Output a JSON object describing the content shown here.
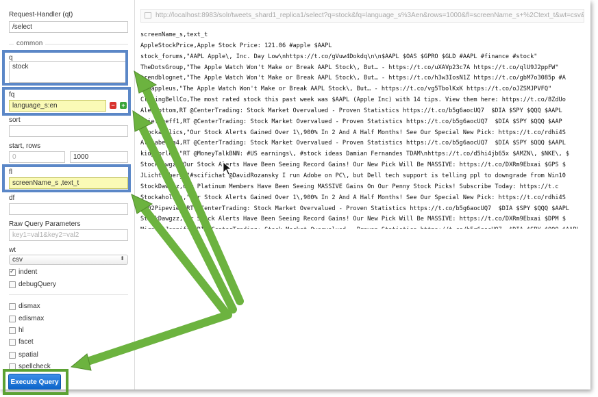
{
  "form": {
    "qt_label": "Request-Handler (qt)",
    "qt_value": "/select",
    "common_label": "common",
    "q_label": "q",
    "q_value": "stock",
    "fq_label": "fq",
    "fq_value": "language_s:en",
    "sort_label": "sort",
    "sort_value": "",
    "start_rows_label": "start, rows",
    "start_value": "0",
    "rows_value": "1000",
    "fl_label": "fl",
    "fl_value": "screenName_s ,text_t",
    "df_label": "df",
    "df_value": "",
    "raw_label": "Raw Query Parameters",
    "raw_placeholder": "key1=val1&key2=val2",
    "wt_label": "wt",
    "wt_value": "csv",
    "indent_label": "indent",
    "indent_checked": true,
    "debug_label": "debugQuery",
    "dismax_label": "dismax",
    "edismax_label": "edismax",
    "hl_label": "hl",
    "facet_label": "facet",
    "spatial_label": "spatial",
    "spellcheck_label": "spellcheck",
    "execute_label": "Execute Query"
  },
  "url": "http://localhost:8983/solr/tweets_shard1_replica1/select?q=stock&fq=language_s%3Aen&rows=1000&fl=screenName_s+%2Ctext_t&wt=csv&indent=true",
  "output_lines": [
    "screenName_s,text_t",
    "AppleStockPrice,Apple Stock Price: 121.06 #apple $AAPL",
    "stock_forums,\"AAPL Apple\\, Inc. Day Low\\nhttps://t.co/gVuw4Dokdq\\n\\n$AAPL $OAS $GPRO $GLD #AAPL #finance #stock\"",
    "TheDotsGroup,\"The Apple Watch Won't Make or Break AAPL Stock\\, But… - https://t.co/uXAVp23c7A https://t.co/qlU9J2ppFW\"",
    "trendblognet,\"The Apple Watch Won't Make or Break AAPL Stock\\, But… - https://t.co/h3w3IosN1Z https://t.co/gbM7o3085p #A",
    "appappleus,\"The Apple Watch Won't Make or Break AAPL Stock\\, But… - https://t.co/vg5TbolKxK https://t.co/oJZSMJPVFQ\"",
    "ClosingBellCo,The most rated stock this past week was $AAPL (Apple Inc) with 14 tips. View them here: https://t.co/8ZdUo",
    "AlexBottom,RT @CenterTrading: Stock Market Overvalued - Proven Statistics https://t.co/b5g6aocUQ7  $DIA $SPY $QQQ $AAPL",
    "chiefkeeff1,RT @CenterTrading: Stock Market Overvalued - Proven Statistics https://t.co/b5g6aocUQ7  $DIA $SPY $QQQ $AAP",
    "Stockaholics,\"Our Stock Alerts Gained Over 1\\,900% In 2 And A Half Months! See Our Special New Pick: https://t.co/rdhi4S",
    "Alisabella4,RT @CenterTrading: Stock Market Overvalued - Proven Statistics https://t.co/b5g6aocUQ7  $DIA $SPY $QQQ $AAPL",
    "kidpaprlee,\"RT @MoneyTalkBNN: #US earnings\\, #stock ideas Damian Fernandes TDAM\\nhttps://t.co/d5hi4jb65x $AMZN\\, $NKE\\, $",
    "StockDawgzz,Our Stock Alerts Have Been Seeing Record Gains! Our New Pick Will Be MASSIVE: https://t.co/DXRm9Ebxai $GPS $",
    "JLichtenberg,\"#scifichat @DavidRozansky I run Adobe on PC\\, but Dell tech support is telling ppl to downgrade from Win10",
    "StockDawgzz,Our Platinum Members Have Been Seeing MASSIVE Gains On Our Penny Stock Picks! Subscribe Today: https://t.c",
    "Stockaholics,\"Our Stock Alerts Gained Over 1\\,900% In 2 And A Half Months! See Our Special New Pick: https://t.co/rdhi4S",
    "1802Pipeview,RT @CenterTrading: Stock Market Overvalued - Proven Statistics https://t.co/b5g6aocUQ7  $DIA $SPY $QQQ $AAPL",
    "StockDawgzz,Our Stock Alerts Have Been Seeing Record Gains! Our New Pick Will Be MASSIVE: https://t.co/DXRm9Ebxai $DPM $",
    "MirandaJennifer,RT @CenterTrading: Stock Market Overvalued - Proven Statistics https://t.co/b5g6aocUQ7  $DIA $SPY $QQQ $AAPL",
    "StockRocket10,Our Platinum Members Have Been Seeing MASSIVE Gains On Our Penny Stock Picks! Subscribe Today: https://t.c"
  ],
  "colors": {
    "highlight_box": "#5b87c7",
    "arrow_green": "#6cb33f",
    "input_highlight": "#fafab6",
    "execute_button": "#1a73d9"
  }
}
